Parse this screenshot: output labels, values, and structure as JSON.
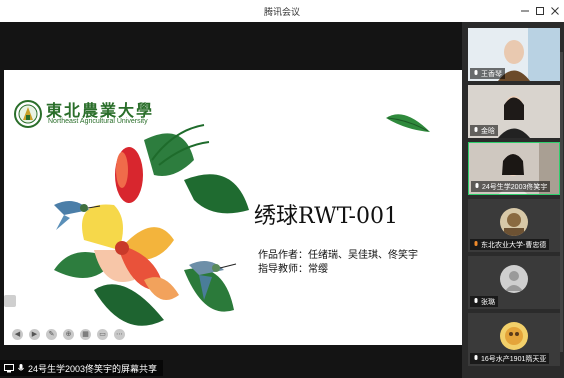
{
  "window": {
    "title": "腾讯会议"
  },
  "slide": {
    "university_cn": "東北農業大學",
    "university_en": "Northeast Agricultural University",
    "title": "绣球RWT-001",
    "authors_line": "作品作者：任绪瑞、吴佳琪、佟笑宇",
    "advisor_line": "指导教师：常缨"
  },
  "share_label": "24号生学2003佟笑宇的屏幕共享",
  "participants": [
    {
      "name": "王香琴",
      "style": "video"
    },
    {
      "name": "金晗",
      "style": "video"
    },
    {
      "name": "24号生学2003佟笑宇",
      "style": "video",
      "active": true
    },
    {
      "name": "东北农业大学-曹忠德",
      "style": "avatar"
    },
    {
      "name": "张璐",
      "style": "blank"
    },
    {
      "name": "16号水产1901隋天亚",
      "style": "avatar"
    }
  ],
  "colors": {
    "accent_green": "#2ecf6c",
    "logo_green": "#2a6e2a"
  },
  "icons": [
    "minimize-icon",
    "maximize-icon",
    "close-icon",
    "mic-icon",
    "share-screen-icon"
  ]
}
